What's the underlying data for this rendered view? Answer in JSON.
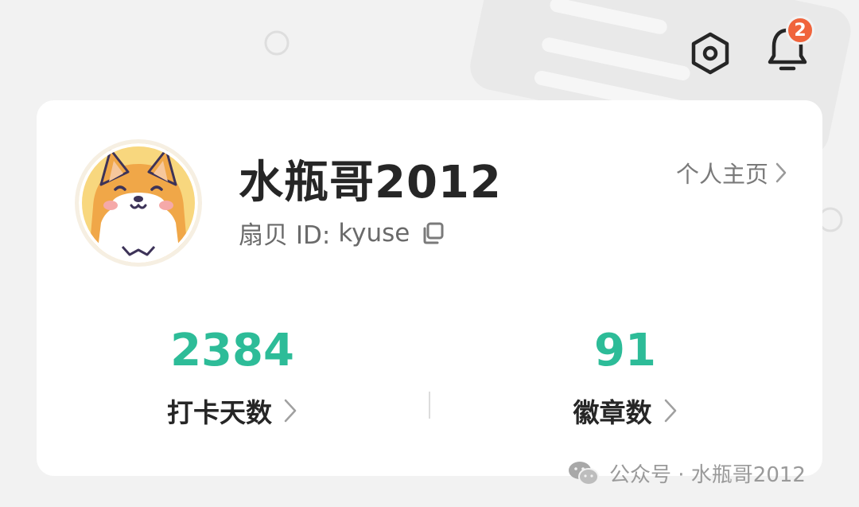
{
  "top_bar": {
    "settings_icon": "hexagon-settings-icon",
    "bell_icon": "bell-icon",
    "notification_count": "2",
    "badge_color": "#f0643c"
  },
  "profile": {
    "avatar_icon": "shiba-dog-avatar",
    "username": "水瓶哥2012",
    "id_label": "扇贝 ID:",
    "id_value": "kyuse",
    "homepage_link": "个人主页"
  },
  "stats": [
    {
      "value": "2384",
      "label": "打卡天数"
    },
    {
      "value": "91",
      "label": "徽章数"
    }
  ],
  "accent_color": "#2dbc98",
  "watermark": {
    "text": "公众号 · 水瓶哥2012"
  }
}
